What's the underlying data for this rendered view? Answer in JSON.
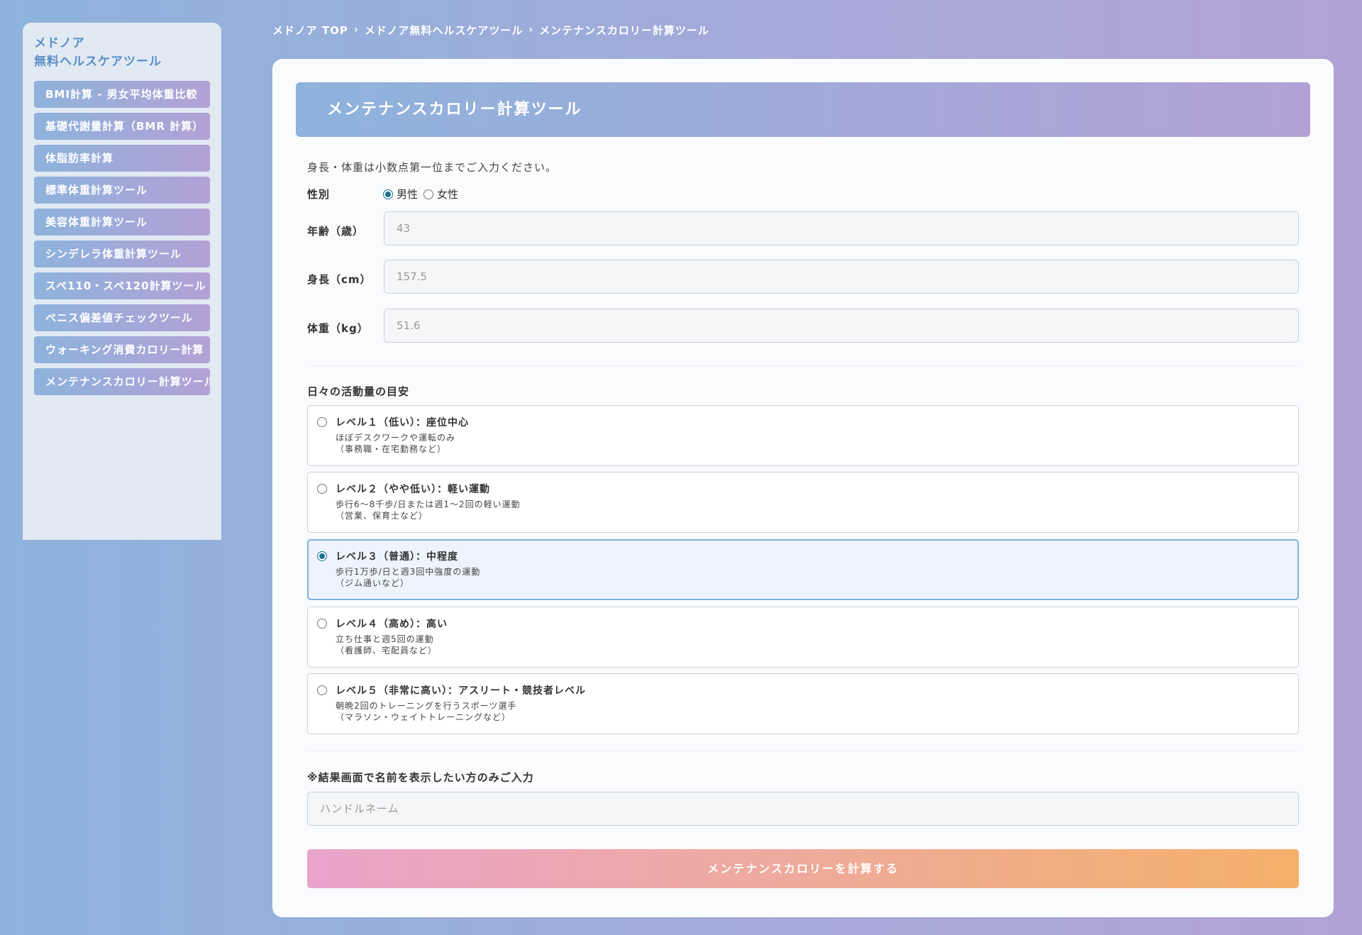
{
  "sidebar": {
    "title_line1": "メドノア",
    "title_line2": "無料ヘルスケアツール",
    "items": [
      {
        "label": "BMI計算 - 男女平均体重比較"
      },
      {
        "label": "基礎代謝量計算（BMR 計算）"
      },
      {
        "label": "体脂肪率計算"
      },
      {
        "label": "標準体重計算ツール"
      },
      {
        "label": "美容体重計算ツール"
      },
      {
        "label": "シンデレラ体重計算ツール"
      },
      {
        "label": "スペ110・スペ120計算ツール"
      },
      {
        "label": "ペニス偏差値チェックツール"
      },
      {
        "label": "ウォーキング消費カロリー計算"
      },
      {
        "label": "メンテナンスカロリー計算ツール"
      }
    ]
  },
  "breadcrumb": {
    "items": [
      "メドノア TOP",
      "メドノア無料ヘルスケアツール",
      "メンテナンスカロリー計算ツール"
    ],
    "separator": "›"
  },
  "header": {
    "title": "メンテナンスカロリー計算ツール"
  },
  "form": {
    "note": "身長・体重は小数点第一位までご入力ください。",
    "gender_label": "性別",
    "gender_options": [
      "男性",
      "女性"
    ],
    "gender_selected": "男性",
    "age_label": "年齢（歳）",
    "age_placeholder": "43",
    "height_label": "身長（cm）",
    "height_placeholder": "157.5",
    "weight_label": "体重（kg）",
    "weight_placeholder": "51.6",
    "activity_title": "日々の活動量の目安",
    "levels": [
      {
        "title": "レベル１（低い）：座位中心",
        "desc1": "ほぼデスクワークや運転のみ",
        "desc2": "（事務職・在宅勤務など）"
      },
      {
        "title": "レベル２（やや低い）：軽い運動",
        "desc1": "歩行6～8千歩/日または週1～2回の軽い運動",
        "desc2": "（営業、保育士など）"
      },
      {
        "title": "レベル３（普通）：中程度",
        "desc1": "歩行1万歩/日と週3回中強度の運動",
        "desc2": "（ジム通いなど）"
      },
      {
        "title": "レベル４（高め）：高い",
        "desc1": "立ち仕事と週5回の運動",
        "desc2": "（看護師、宅配員など）"
      },
      {
        "title": "レベル５（非常に高い）：アスリート・競技者レベル",
        "desc1": "朝晩2回のトレーニングを行うスポーツ選手",
        "desc2": "（マラソン・ウェイトトレーニングなど）"
      }
    ],
    "selected_level": 3,
    "name_note": "※結果画面で名前を表示したい方のみご入力",
    "name_placeholder": "ハンドルネーム",
    "submit_label": "メンテナンスカロリーを計算する"
  }
}
